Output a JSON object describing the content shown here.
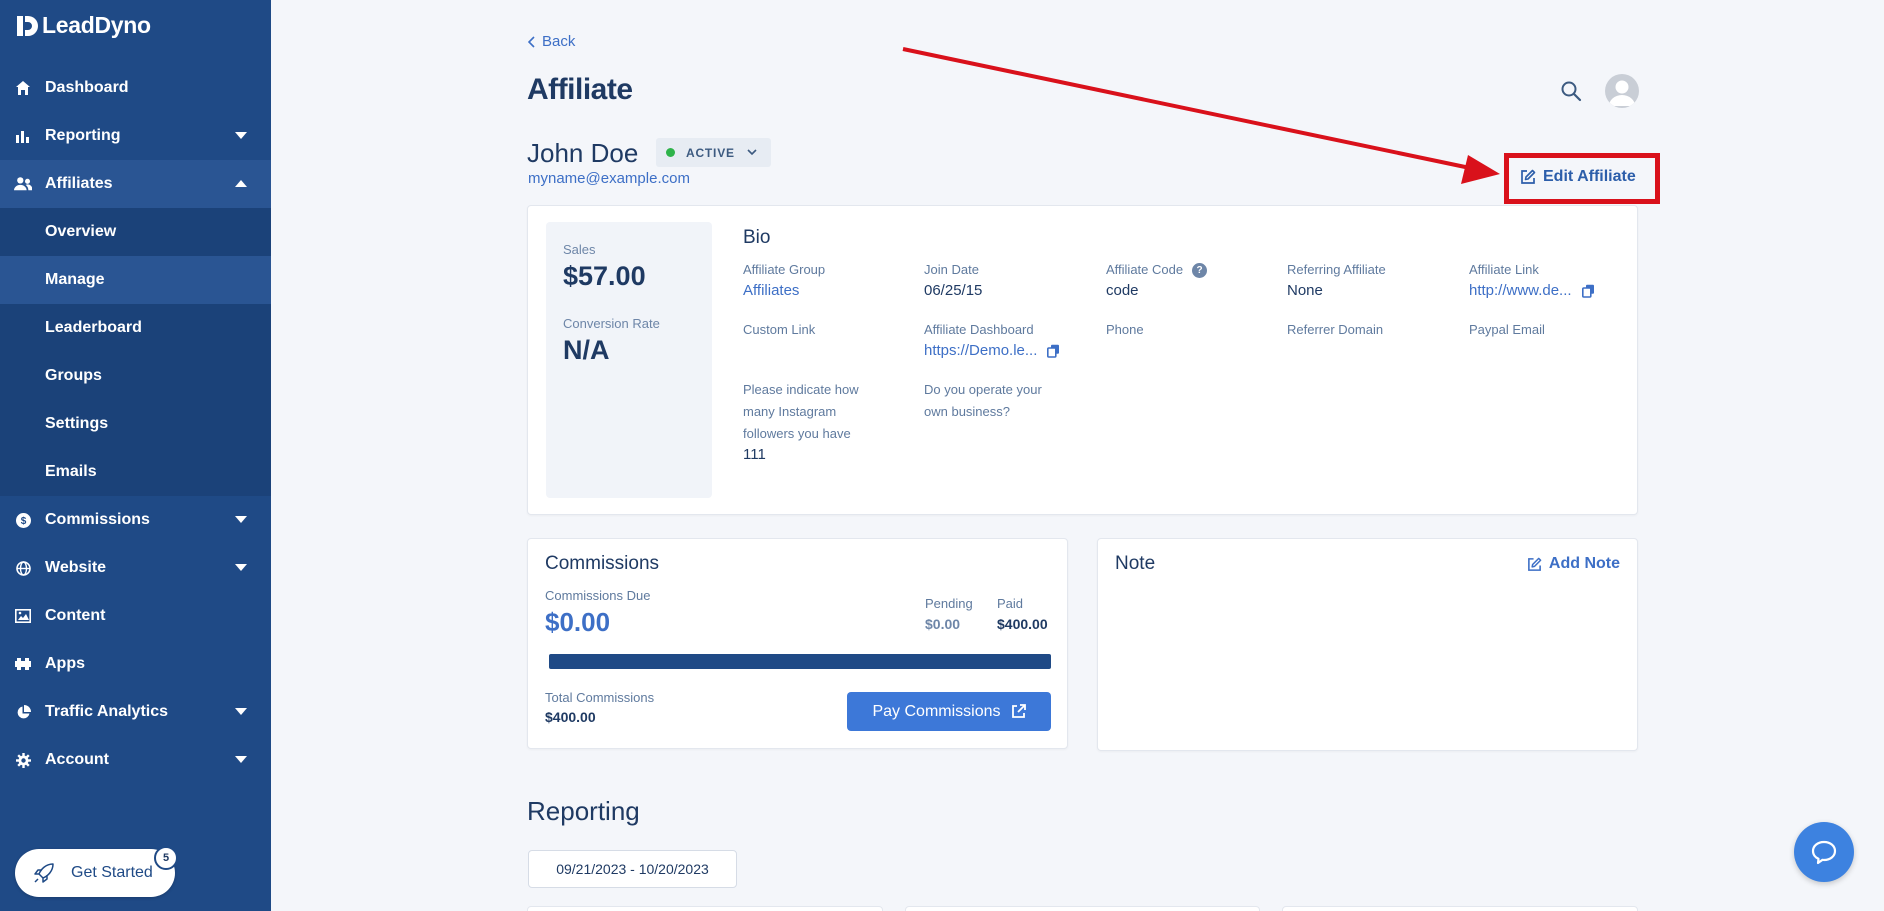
{
  "brand": {
    "name": "LeadDyno"
  },
  "sidebar": {
    "items": [
      {
        "label": "Dashboard",
        "icon": "home-icon"
      },
      {
        "label": "Reporting",
        "icon": "bar-chart-icon"
      },
      {
        "label": "Affiliates",
        "icon": "users-icon"
      },
      {
        "label": "Commissions",
        "icon": "dollar-icon"
      },
      {
        "label": "Website",
        "icon": "globe-icon"
      },
      {
        "label": "Content",
        "icon": "image-icon"
      },
      {
        "label": "Apps",
        "icon": "puzzle-icon"
      },
      {
        "label": "Traffic Analytics",
        "icon": "pie-chart-icon"
      },
      {
        "label": "Account",
        "icon": "gear-icon"
      }
    ],
    "affiliates_sub": [
      "Overview",
      "Manage",
      "Leaderboard",
      "Groups",
      "Settings",
      "Emails"
    ],
    "active_sub": "Manage",
    "get_started": {
      "label": "Get Started",
      "badge": "5"
    }
  },
  "header": {
    "back_label": "Back",
    "title": "Affiliate"
  },
  "affiliate": {
    "name": "John Doe",
    "status": "ACTIVE",
    "email": "myname@example.com",
    "edit_label": "Edit Affiliate"
  },
  "stats": {
    "sales_label": "Sales",
    "sales_value": "$57.00",
    "conversion_label": "Conversion Rate",
    "conversion_value": "N/A"
  },
  "bio": {
    "title": "Bio",
    "fields": {
      "affiliate_group": {
        "label": "Affiliate Group",
        "value": "Affiliates"
      },
      "join_date": {
        "label": "Join Date",
        "value": "06/25/15"
      },
      "affiliate_code": {
        "label": "Affiliate Code",
        "value": "code"
      },
      "referring_affiliate": {
        "label": "Referring Affiliate",
        "value": "None"
      },
      "affiliate_link": {
        "label": "Affiliate Link",
        "value": "http://www.de..."
      },
      "custom_link": {
        "label": "Custom Link",
        "value": ""
      },
      "affiliate_dashboard": {
        "label": "Affiliate Dashboard",
        "value": "https://Demo.le..."
      },
      "phone": {
        "label": "Phone",
        "value": ""
      },
      "referrer_domain": {
        "label": "Referrer Domain",
        "value": ""
      },
      "paypal_email": {
        "label": "Paypal Email",
        "value": ""
      },
      "instagram": {
        "label": "Please indicate how many Instagram followers you have",
        "value": "111"
      },
      "own_business": {
        "label": "Do you operate your own business?",
        "value": ""
      }
    }
  },
  "commissions": {
    "title": "Commissions",
    "due_label": "Commissions Due",
    "due_value": "$0.00",
    "pending_label": "Pending",
    "pending_value": "$0.00",
    "paid_label": "Paid",
    "paid_value": "$400.00",
    "paid_fraction": 1.0,
    "total_label": "Total Commissions",
    "total_value": "$400.00",
    "pay_label": "Pay Commissions"
  },
  "note": {
    "title": "Note",
    "add_label": "Add Note"
  },
  "reporting": {
    "title": "Reporting",
    "date_range": "09/21/2023 - 10/20/2023"
  },
  "colors": {
    "sidebar": "#1f4a86",
    "accent": "#3d78d8",
    "highlight": "#d9111b",
    "active_dot": "#2eb34a"
  }
}
